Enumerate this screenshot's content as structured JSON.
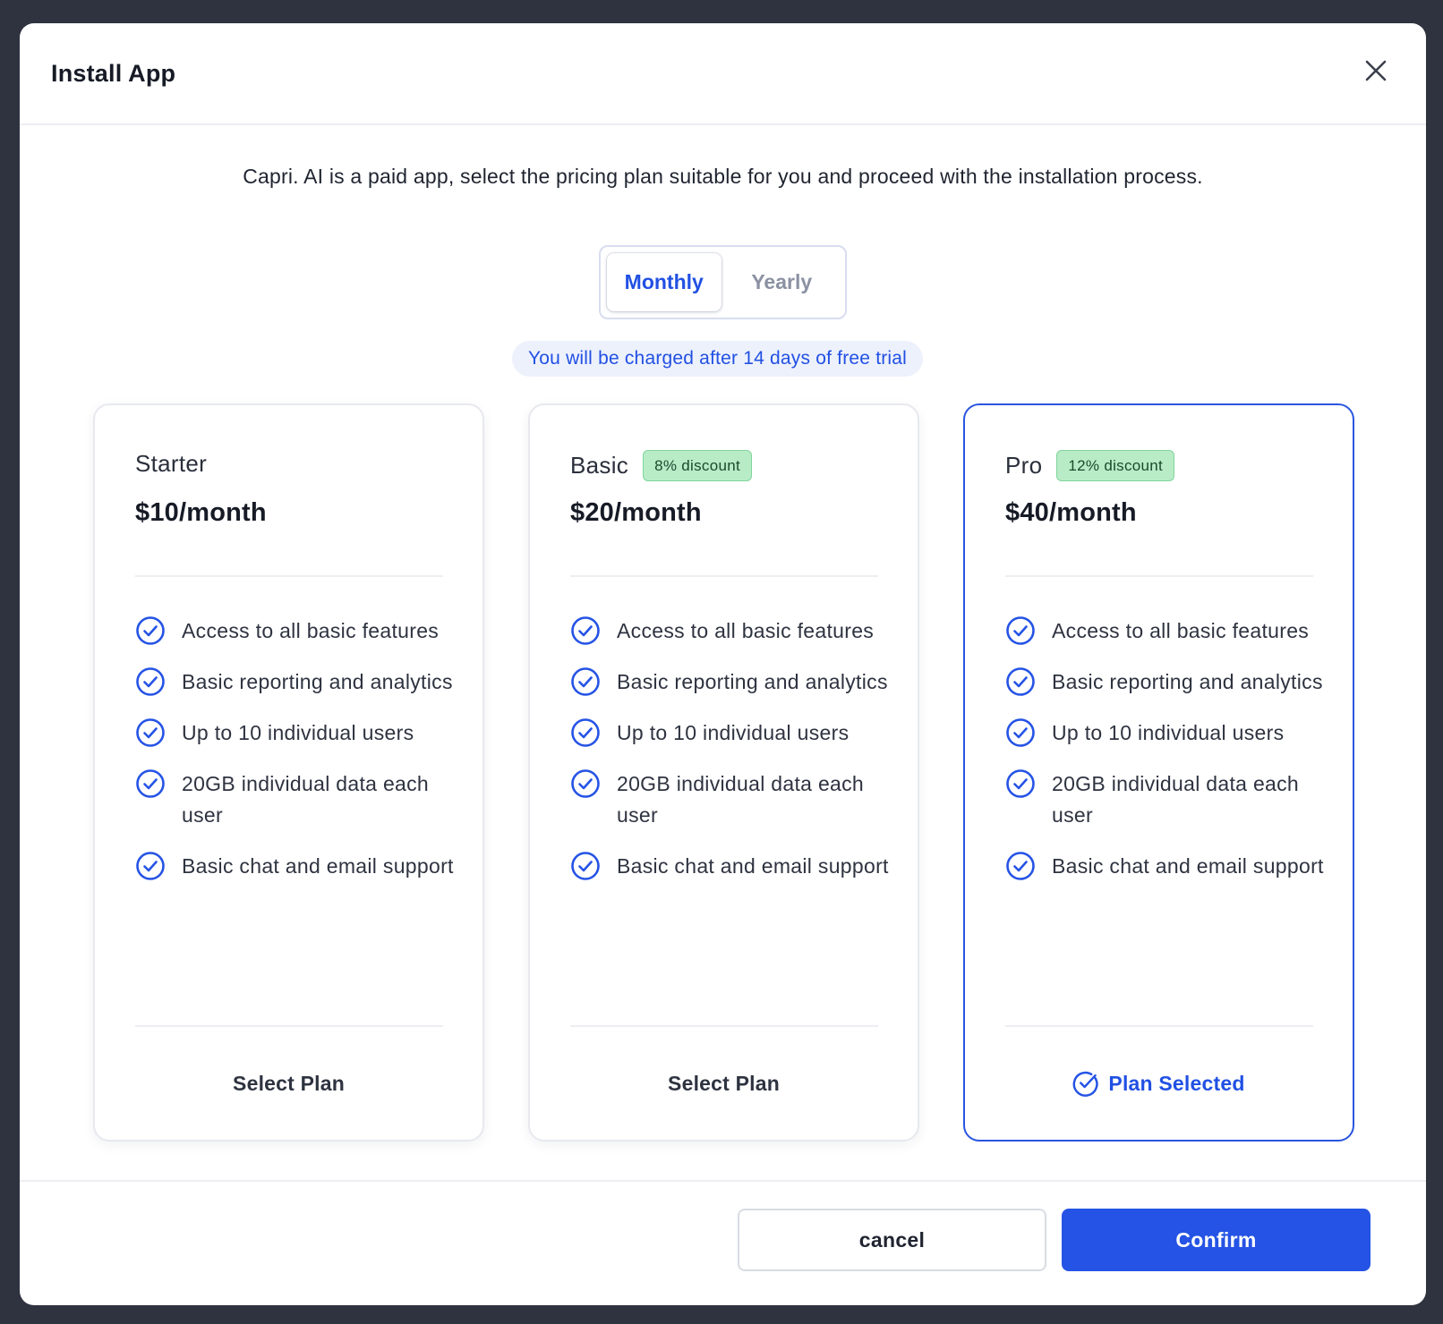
{
  "modal": {
    "title": "Install App",
    "intro": "Capri. AI is a paid app, select the pricing plan suitable for you and proceed with the installation process."
  },
  "billing_toggle": {
    "options": [
      "Monthly",
      "Yearly"
    ],
    "selected": "Monthly"
  },
  "trial_notice": "You will be charged after 14 days of free trial",
  "plans": [
    {
      "name": "Starter",
      "discount": "",
      "price": "$10/month",
      "features": [
        "Access to all basic features",
        "Basic reporting and analytics",
        "Up to 10 individual users",
        "20GB individual data each user",
        "Basic chat and email support"
      ],
      "action": "Select Plan",
      "selected": false
    },
    {
      "name": "Basic",
      "discount": "8% discount",
      "price": "$20/month",
      "features": [
        "Access to all basic features",
        "Basic reporting and analytics",
        "Up to 10 individual users",
        "20GB individual data each user",
        "Basic chat and email support"
      ],
      "action": "Select Plan",
      "selected": false
    },
    {
      "name": "Pro",
      "discount": "12% discount",
      "price": "$40/month",
      "features": [
        "Access to all basic features",
        "Basic reporting and analytics",
        "Up to 10 individual users",
        "20GB individual data each user",
        "Basic chat and email support"
      ],
      "action": "Plan Selected",
      "selected": true
    }
  ],
  "footer": {
    "cancel_label": "cancel",
    "confirm_label": "Confirm"
  },
  "colors": {
    "accent": "#2553e5",
    "discount_bg": "#b8ecc7",
    "backdrop": "#2f3340"
  },
  "icons": {
    "close": "close-icon",
    "feature": "check-circle-icon",
    "selected": "check-circle-icon"
  }
}
